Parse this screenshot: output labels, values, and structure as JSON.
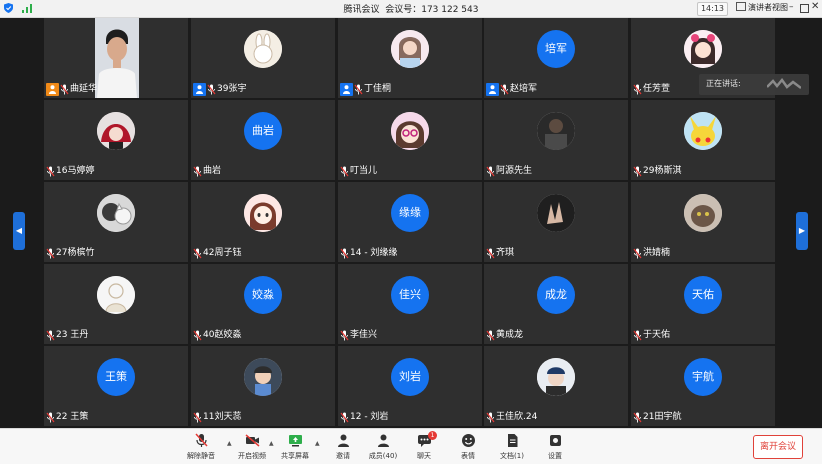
{
  "titlebar": {
    "title": "腾讯会议  会议号：173 122 543",
    "time": "14:13",
    "view_label": "演讲者视图"
  },
  "speaking": {
    "label": "正在讲话:"
  },
  "participants": [
    {
      "name": "曲延华",
      "type": "video",
      "badge": "host"
    },
    {
      "name": "39张宇",
      "type": "photo",
      "photo": "rabbit-avatar",
      "badge": "cohost"
    },
    {
      "name": "丁佳桐",
      "type": "photo",
      "photo": "girl-avatar",
      "badge": "cohost"
    },
    {
      "name": "赵培军",
      "type": "text",
      "avatar_text": "培军",
      "badge": "cohost"
    },
    {
      "name": "任芳萱",
      "type": "photo",
      "photo": "cartoon-girl-avatar"
    },
    {
      "name": "16马婷婷",
      "type": "photo",
      "photo": "anime-red-avatar"
    },
    {
      "name": "曲岩",
      "type": "text",
      "avatar_text": "曲岩"
    },
    {
      "name": "叮当儿",
      "type": "photo",
      "photo": "glasses-girl-avatar"
    },
    {
      "name": "阿源先生",
      "type": "photo",
      "photo": "dark-photo-avatar"
    },
    {
      "name": "29杨斯淇",
      "type": "photo",
      "photo": "pikachu-avatar"
    },
    {
      "name": "27杨槟竹",
      "type": "photo",
      "photo": "cat-avatar"
    },
    {
      "name": "42周子钰",
      "type": "photo",
      "photo": "cartoon-crying-avatar"
    },
    {
      "name": "14 - 刘缘缘",
      "type": "text",
      "avatar_text": "缘缘"
    },
    {
      "name": "齐琪",
      "type": "photo",
      "photo": "hand-avatar"
    },
    {
      "name": "洪婧楠",
      "type": "photo",
      "photo": "cat-face-avatar"
    },
    {
      "name": "23 王丹",
      "type": "photo",
      "photo": "sketch-avatar"
    },
    {
      "name": "40赵姣淼",
      "type": "text",
      "avatar_text": "姣淼"
    },
    {
      "name": "李佳兴",
      "type": "text",
      "avatar_text": "佳兴"
    },
    {
      "name": "黄成龙",
      "type": "text",
      "avatar_text": "成龙"
    },
    {
      "name": "于天佑",
      "type": "text",
      "avatar_text": "天佑"
    },
    {
      "name": "22 王策",
      "type": "text",
      "avatar_text": "王策"
    },
    {
      "name": "11刘天蕊",
      "type": "photo",
      "photo": "boy-cartoon-avatar"
    },
    {
      "name": "12 - 刘岩",
      "type": "text",
      "avatar_text": "刘岩"
    },
    {
      "name": "王佳欣.24",
      "type": "photo",
      "photo": "cap-person-avatar"
    },
    {
      "name": "21田宇航",
      "type": "text",
      "avatar_text": "宇航"
    }
  ],
  "toolbar": {
    "mute_label": "解除静音",
    "video_label": "开启视频",
    "share_label": "共享屏幕",
    "invite_label": "邀请",
    "members_label": "成员(40)",
    "chat_label": "聊天",
    "chat_badge": "1",
    "emoji_label": "表情",
    "docs_label": "文档(1)",
    "settings_label": "设置",
    "leave_label": "离开会议"
  },
  "colors": {
    "accent_blue": "#1573f0",
    "host_orange": "#f08a18",
    "leave_red": "#e0423a",
    "tile_bg": "#2f2f2f"
  }
}
